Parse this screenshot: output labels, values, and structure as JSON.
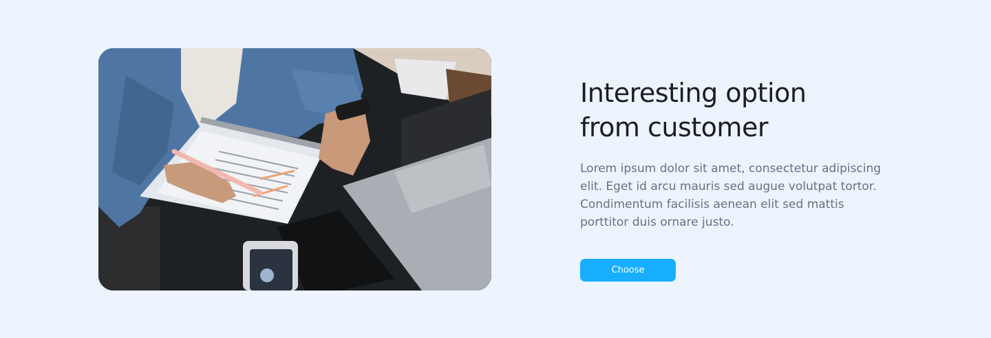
{
  "feature": {
    "title": "Interesting option from customer",
    "description": "Lorem ipsum dolor sit amet, consectetur adipiscing elit. Eget id arcu mauris sed augue volutpat tortor. Condimentum facilisis aenean elit sed mattis porttitor duis ornare justo.",
    "button_label": "Choose",
    "colors": {
      "background": "#edf4fd",
      "title": "#1b1d24",
      "body": "#6b6f80",
      "accent": "#17aeff"
    }
  }
}
